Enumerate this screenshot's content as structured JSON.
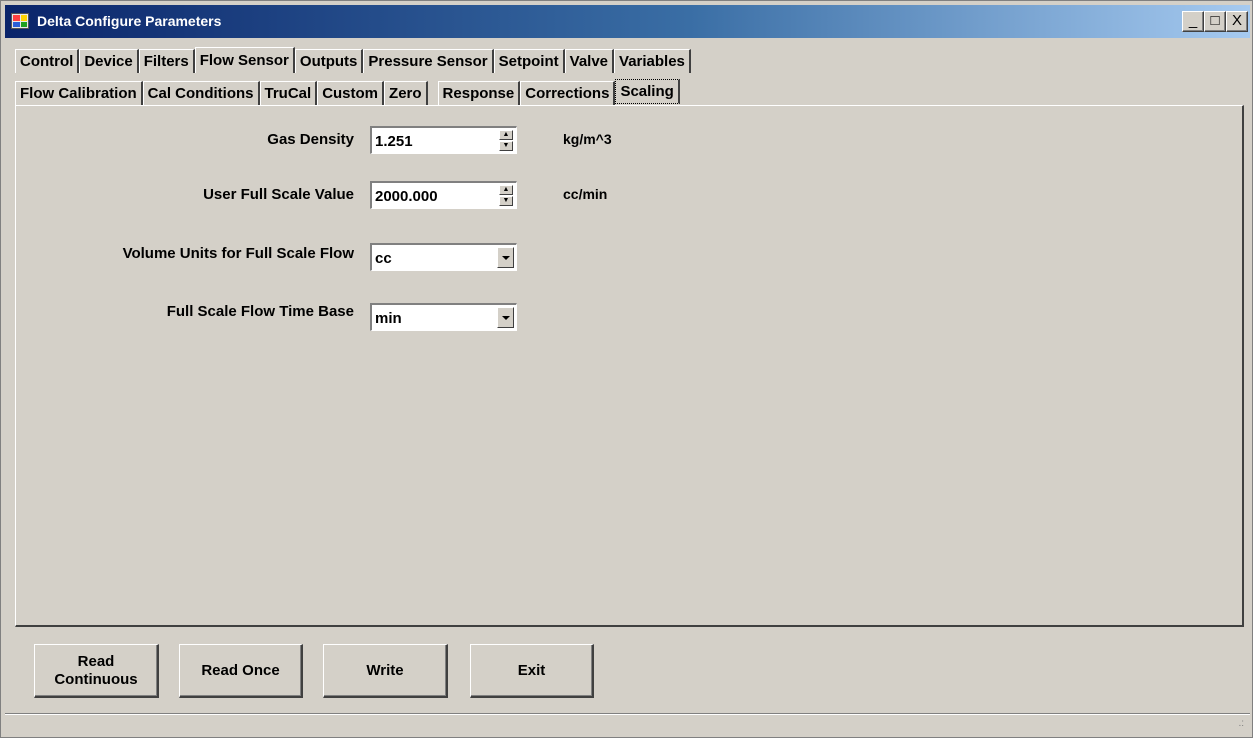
{
  "window": {
    "title": "Delta Configure Parameters"
  },
  "caption_buttons": {
    "minimize": "_",
    "maximize": "□",
    "close": "X"
  },
  "tabs_top": [
    "Control",
    "Device",
    "Filters",
    "Flow Sensor",
    "Outputs",
    "Pressure Sensor",
    "Setpoint",
    "Valve",
    "Variables"
  ],
  "tabs_top_active": "Flow Sensor",
  "tabs_sub": [
    "Flow Calibration",
    "Cal Conditions",
    "TruCal",
    "Custom",
    "Zero",
    "Response",
    "Corrections",
    "Scaling"
  ],
  "tabs_sub_active": "Scaling",
  "fields": {
    "gas_density": {
      "label": "Gas Density",
      "value": "1.251",
      "unit": "kg/m^3"
    },
    "user_full_scale": {
      "label": "User Full Scale Value",
      "value": "2000.000",
      "unit": "cc/min"
    },
    "volume_units": {
      "label": "Volume Units for Full Scale Flow",
      "value": "cc"
    },
    "time_base": {
      "label": "Full Scale Flow Time Base",
      "value": "min"
    }
  },
  "buttons": {
    "read_continuous_line1": "Read",
    "read_continuous_line2": "Continuous",
    "read_once": "Read Once",
    "write": "Write",
    "exit": "Exit"
  }
}
